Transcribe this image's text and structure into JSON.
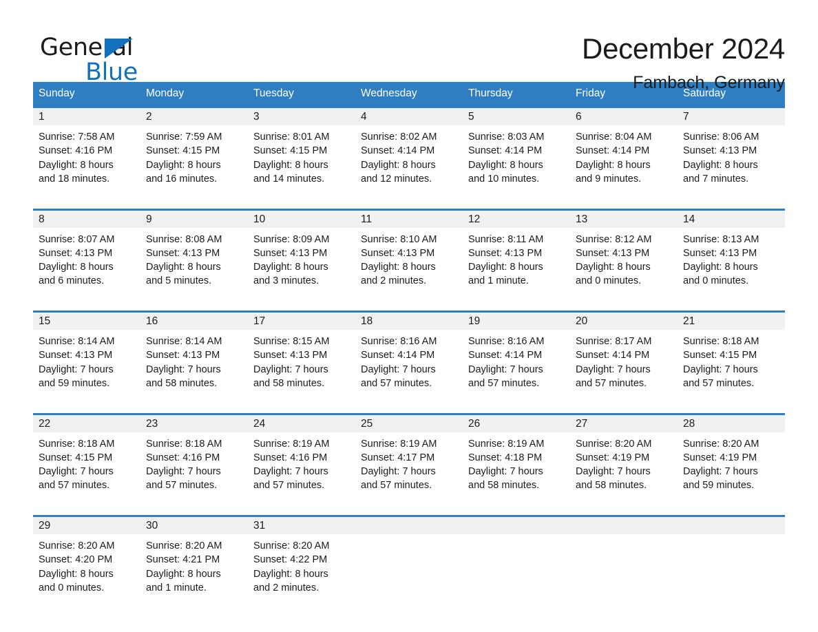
{
  "logo": {
    "word_one": "General",
    "word_two": "Blue",
    "triangle_color": "#1271bb",
    "icon": "general-blue-logo"
  },
  "header": {
    "title": "December 2024",
    "subtitle": "Fambach, Germany"
  },
  "theme": {
    "header_blue": "#2f7ec1",
    "row_divider_blue": "#2f7ec1",
    "daynum_background": "#f1f1f1",
    "text": "#1b1b1b",
    "page_background": "#ffffff"
  },
  "calendar": {
    "weekday_headers": [
      "Sunday",
      "Monday",
      "Tuesday",
      "Wednesday",
      "Thursday",
      "Friday",
      "Saturday"
    ],
    "weeks": [
      [
        {
          "day": "1",
          "sunrise": "Sunrise: 7:58 AM",
          "sunset": "Sunset: 4:16 PM",
          "daylight_1": "Daylight: 8 hours",
          "daylight_2": "and 18 minutes."
        },
        {
          "day": "2",
          "sunrise": "Sunrise: 7:59 AM",
          "sunset": "Sunset: 4:15 PM",
          "daylight_1": "Daylight: 8 hours",
          "daylight_2": "and 16 minutes."
        },
        {
          "day": "3",
          "sunrise": "Sunrise: 8:01 AM",
          "sunset": "Sunset: 4:15 PM",
          "daylight_1": "Daylight: 8 hours",
          "daylight_2": "and 14 minutes."
        },
        {
          "day": "4",
          "sunrise": "Sunrise: 8:02 AM",
          "sunset": "Sunset: 4:14 PM",
          "daylight_1": "Daylight: 8 hours",
          "daylight_2": "and 12 minutes."
        },
        {
          "day": "5",
          "sunrise": "Sunrise: 8:03 AM",
          "sunset": "Sunset: 4:14 PM",
          "daylight_1": "Daylight: 8 hours",
          "daylight_2": "and 10 minutes."
        },
        {
          "day": "6",
          "sunrise": "Sunrise: 8:04 AM",
          "sunset": "Sunset: 4:14 PM",
          "daylight_1": "Daylight: 8 hours",
          "daylight_2": "and 9 minutes."
        },
        {
          "day": "7",
          "sunrise": "Sunrise: 8:06 AM",
          "sunset": "Sunset: 4:13 PM",
          "daylight_1": "Daylight: 8 hours",
          "daylight_2": "and 7 minutes."
        }
      ],
      [
        {
          "day": "8",
          "sunrise": "Sunrise: 8:07 AM",
          "sunset": "Sunset: 4:13 PM",
          "daylight_1": "Daylight: 8 hours",
          "daylight_2": "and 6 minutes."
        },
        {
          "day": "9",
          "sunrise": "Sunrise: 8:08 AM",
          "sunset": "Sunset: 4:13 PM",
          "daylight_1": "Daylight: 8 hours",
          "daylight_2": "and 5 minutes."
        },
        {
          "day": "10",
          "sunrise": "Sunrise: 8:09 AM",
          "sunset": "Sunset: 4:13 PM",
          "daylight_1": "Daylight: 8 hours",
          "daylight_2": "and 3 minutes."
        },
        {
          "day": "11",
          "sunrise": "Sunrise: 8:10 AM",
          "sunset": "Sunset: 4:13 PM",
          "daylight_1": "Daylight: 8 hours",
          "daylight_2": "and 2 minutes."
        },
        {
          "day": "12",
          "sunrise": "Sunrise: 8:11 AM",
          "sunset": "Sunset: 4:13 PM",
          "daylight_1": "Daylight: 8 hours",
          "daylight_2": "and 1 minute."
        },
        {
          "day": "13",
          "sunrise": "Sunrise: 8:12 AM",
          "sunset": "Sunset: 4:13 PM",
          "daylight_1": "Daylight: 8 hours",
          "daylight_2": "and 0 minutes."
        },
        {
          "day": "14",
          "sunrise": "Sunrise: 8:13 AM",
          "sunset": "Sunset: 4:13 PM",
          "daylight_1": "Daylight: 8 hours",
          "daylight_2": "and 0 minutes."
        }
      ],
      [
        {
          "day": "15",
          "sunrise": "Sunrise: 8:14 AM",
          "sunset": "Sunset: 4:13 PM",
          "daylight_1": "Daylight: 7 hours",
          "daylight_2": "and 59 minutes."
        },
        {
          "day": "16",
          "sunrise": "Sunrise: 8:14 AM",
          "sunset": "Sunset: 4:13 PM",
          "daylight_1": "Daylight: 7 hours",
          "daylight_2": "and 58 minutes."
        },
        {
          "day": "17",
          "sunrise": "Sunrise: 8:15 AM",
          "sunset": "Sunset: 4:13 PM",
          "daylight_1": "Daylight: 7 hours",
          "daylight_2": "and 58 minutes."
        },
        {
          "day": "18",
          "sunrise": "Sunrise: 8:16 AM",
          "sunset": "Sunset: 4:14 PM",
          "daylight_1": "Daylight: 7 hours",
          "daylight_2": "and 57 minutes."
        },
        {
          "day": "19",
          "sunrise": "Sunrise: 8:16 AM",
          "sunset": "Sunset: 4:14 PM",
          "daylight_1": "Daylight: 7 hours",
          "daylight_2": "and 57 minutes."
        },
        {
          "day": "20",
          "sunrise": "Sunrise: 8:17 AM",
          "sunset": "Sunset: 4:14 PM",
          "daylight_1": "Daylight: 7 hours",
          "daylight_2": "and 57 minutes."
        },
        {
          "day": "21",
          "sunrise": "Sunrise: 8:18 AM",
          "sunset": "Sunset: 4:15 PM",
          "daylight_1": "Daylight: 7 hours",
          "daylight_2": "and 57 minutes."
        }
      ],
      [
        {
          "day": "22",
          "sunrise": "Sunrise: 8:18 AM",
          "sunset": "Sunset: 4:15 PM",
          "daylight_1": "Daylight: 7 hours",
          "daylight_2": "and 57 minutes."
        },
        {
          "day": "23",
          "sunrise": "Sunrise: 8:18 AM",
          "sunset": "Sunset: 4:16 PM",
          "daylight_1": "Daylight: 7 hours",
          "daylight_2": "and 57 minutes."
        },
        {
          "day": "24",
          "sunrise": "Sunrise: 8:19 AM",
          "sunset": "Sunset: 4:16 PM",
          "daylight_1": "Daylight: 7 hours",
          "daylight_2": "and 57 minutes."
        },
        {
          "day": "25",
          "sunrise": "Sunrise: 8:19 AM",
          "sunset": "Sunset: 4:17 PM",
          "daylight_1": "Daylight: 7 hours",
          "daylight_2": "and 57 minutes."
        },
        {
          "day": "26",
          "sunrise": "Sunrise: 8:19 AM",
          "sunset": "Sunset: 4:18 PM",
          "daylight_1": "Daylight: 7 hours",
          "daylight_2": "and 58 minutes."
        },
        {
          "day": "27",
          "sunrise": "Sunrise: 8:20 AM",
          "sunset": "Sunset: 4:19 PM",
          "daylight_1": "Daylight: 7 hours",
          "daylight_2": "and 58 minutes."
        },
        {
          "day": "28",
          "sunrise": "Sunrise: 8:20 AM",
          "sunset": "Sunset: 4:19 PM",
          "daylight_1": "Daylight: 7 hours",
          "daylight_2": "and 59 minutes."
        }
      ],
      [
        {
          "day": "29",
          "sunrise": "Sunrise: 8:20 AM",
          "sunset": "Sunset: 4:20 PM",
          "daylight_1": "Daylight: 8 hours",
          "daylight_2": "and 0 minutes."
        },
        {
          "day": "30",
          "sunrise": "Sunrise: 8:20 AM",
          "sunset": "Sunset: 4:21 PM",
          "daylight_1": "Daylight: 8 hours",
          "daylight_2": "and 1 minute."
        },
        {
          "day": "31",
          "sunrise": "Sunrise: 8:20 AM",
          "sunset": "Sunset: 4:22 PM",
          "daylight_1": "Daylight: 8 hours",
          "daylight_2": "and 2 minutes."
        },
        {
          "day": "",
          "sunrise": "",
          "sunset": "",
          "daylight_1": "",
          "daylight_2": ""
        },
        {
          "day": "",
          "sunrise": "",
          "sunset": "",
          "daylight_1": "",
          "daylight_2": ""
        },
        {
          "day": "",
          "sunrise": "",
          "sunset": "",
          "daylight_1": "",
          "daylight_2": ""
        },
        {
          "day": "",
          "sunrise": "",
          "sunset": "",
          "daylight_1": "",
          "daylight_2": ""
        }
      ]
    ]
  }
}
